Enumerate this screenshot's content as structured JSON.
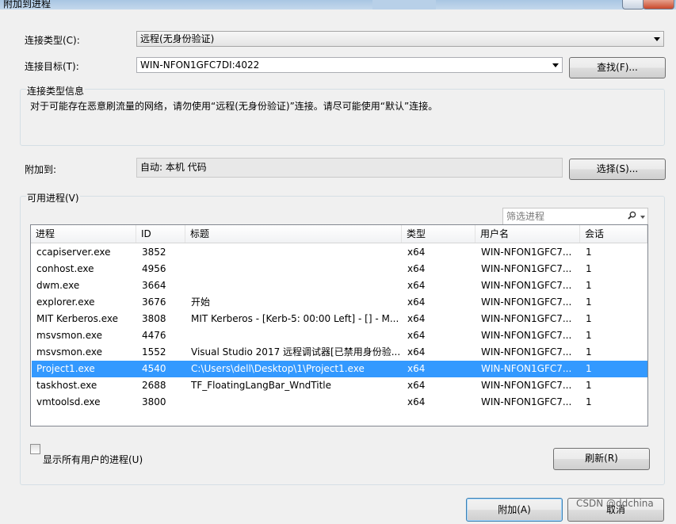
{
  "window": {
    "title": "附加到进程"
  },
  "connection": {
    "type_label": "连接类型(C):",
    "type_value": "远程(无身份验证)",
    "target_label": "连接目标(T):",
    "target_value": "WIN-NFON1GFC7DI:4022",
    "find_button": "查找(F)...",
    "info_title": "连接类型信息",
    "info_text": "对于可能存在恶意刷流量的网络，请勿使用“远程(无身份验证)”连接。请尽可能使用“默认”连接。"
  },
  "attach": {
    "label": "附加到:",
    "value": "自动: 本机 代码",
    "select_button": "选择(S)..."
  },
  "processes": {
    "group_label": "可用进程(V)",
    "filter_placeholder": "筛选进程",
    "columns": [
      "进程",
      "ID",
      "标题",
      "类型",
      "用户名",
      "会话"
    ],
    "rows": [
      {
        "name": "ccapiserver.exe",
        "id": "3852",
        "title": "",
        "type": "x64",
        "user": "WIN-NFON1GFC7...",
        "session": "1"
      },
      {
        "name": "conhost.exe",
        "id": "4956",
        "title": "",
        "type": "x64",
        "user": "WIN-NFON1GFC7...",
        "session": "1"
      },
      {
        "name": "dwm.exe",
        "id": "3664",
        "title": "",
        "type": "x64",
        "user": "WIN-NFON1GFC7...",
        "session": "1"
      },
      {
        "name": "explorer.exe",
        "id": "3676",
        "title": "开始",
        "type": "x64",
        "user": "WIN-NFON1GFC7...",
        "session": "1"
      },
      {
        "name": "MIT Kerberos.exe",
        "id": "3808",
        "title": "MIT Kerberos - [Kerb-5: 00:00 Left] - [] - M...",
        "type": "x64",
        "user": "WIN-NFON1GFC7...",
        "session": "1"
      },
      {
        "name": "msvsmon.exe",
        "id": "4476",
        "title": "",
        "type": "x64",
        "user": "WIN-NFON1GFC7...",
        "session": "1"
      },
      {
        "name": "msvsmon.exe",
        "id": "1552",
        "title": "Visual Studio 2017 远程调试器[已禁用身份验...",
        "type": "x64",
        "user": "WIN-NFON1GFC7...",
        "session": "1"
      },
      {
        "name": "Project1.exe",
        "id": "4540",
        "title": "C:\\Users\\dell\\Desktop\\1\\Project1.exe",
        "type": "x64",
        "user": "WIN-NFON1GFC7...",
        "session": "1"
      },
      {
        "name": "taskhost.exe",
        "id": "2688",
        "title": "TF_FloatingLangBar_WndTitle",
        "type": "x64",
        "user": "WIN-NFON1GFC7...",
        "session": "1"
      },
      {
        "name": "vmtoolsd.exe",
        "id": "3800",
        "title": "",
        "type": "x64",
        "user": "WIN-NFON1GFC7...",
        "session": "1"
      }
    ],
    "selected_row": 7,
    "show_all_label": "显示所有用户的进程(U)",
    "refresh_button": "刷新(R)"
  },
  "footer": {
    "attach_button": "附加(A)",
    "cancel_button": "取消",
    "watermark": "CSDN @ddchina"
  },
  "colors": {
    "selection": "#3399ff",
    "background": "#f0f0f0"
  }
}
